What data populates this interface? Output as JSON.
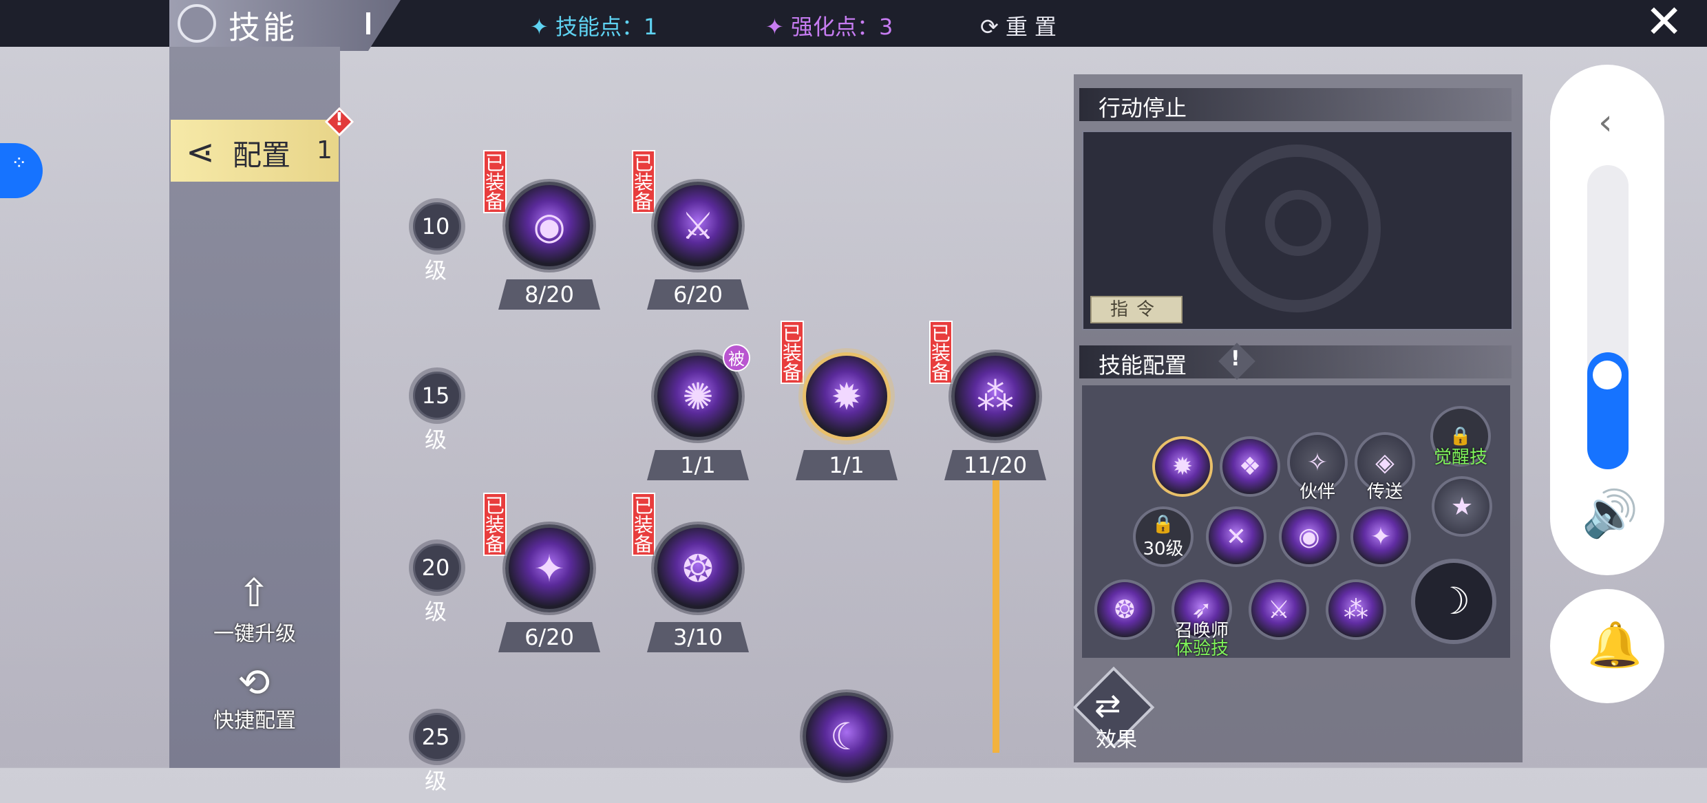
{
  "header": {
    "title": "技能",
    "skill_points": "技能点：1",
    "enhance_points": "强化点：3",
    "reset": "重置",
    "close_icon": "close-icon"
  },
  "sidebar": {
    "config_label": "配置",
    "config_number": "1",
    "one_key_upgrade": "一键升级",
    "quick_config": "快捷配置"
  },
  "tree": {
    "equipped_tag": "已装备",
    "passive_tag": "被",
    "levels": [
      "10级",
      "15级",
      "20级",
      "25级"
    ],
    "counts": {
      "r10a": "8/20",
      "r10b": "6/20",
      "r15a": "1/1",
      "r15b": "1/1",
      "r15c": "11/20",
      "r20a": "6/20",
      "r20b": "3/10"
    }
  },
  "right_panel": {
    "action_title": "行动停止",
    "command_button": "指令",
    "skill_config_title": "技能配置",
    "alert_mark": "!",
    "slots": {
      "companion": "伙伴",
      "teleport": "传送",
      "awaken": "觉醒技",
      "lock_level": "30级",
      "summoner": "召唤师",
      "trial": "体验技"
    },
    "effect_label": "效果"
  },
  "colors": {
    "skill_points": "#5fd3f2",
    "enhance_points": "#c77cf2",
    "equipped_tag": "#e83d3d",
    "accent_blue": "#1673ff",
    "gold_line": "#f2b23e"
  }
}
